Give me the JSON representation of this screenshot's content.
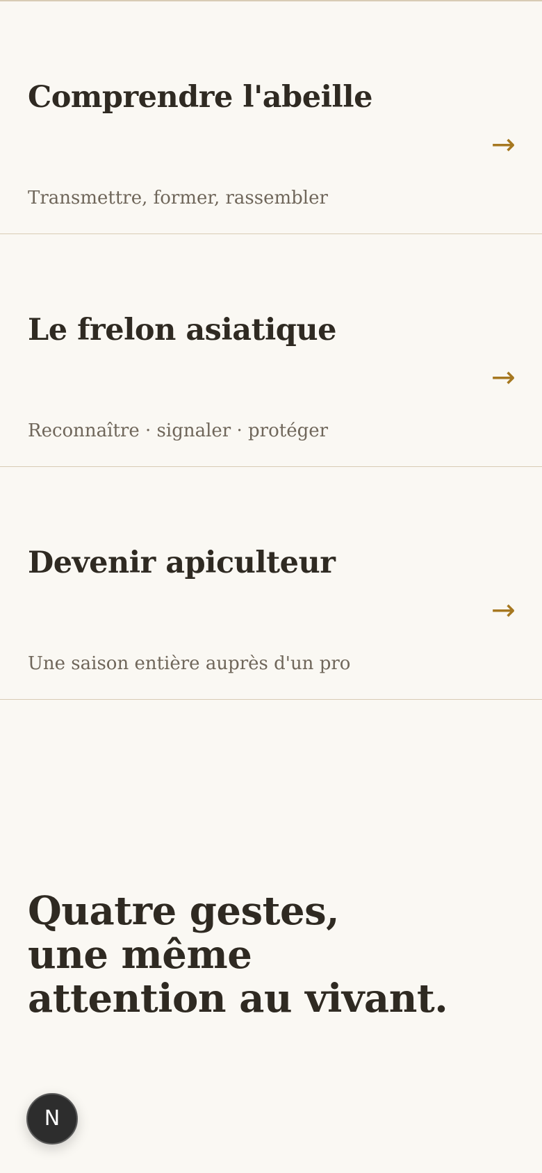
{
  "cards": [
    {
      "title": "Comprendre l'abeille",
      "subtitle": "Transmettre, former, rassembler",
      "arrow": "→"
    },
    {
      "title": "Le frelon asiatique",
      "subtitle": "Reconnaître · signaler · protéger",
      "arrow": "→"
    },
    {
      "title": "Devenir apiculteur",
      "subtitle": "Une saison entière auprès d'un pro",
      "arrow": "→"
    }
  ],
  "tagline": {
    "line1": "Quatre gestes,",
    "line2": "une même",
    "line3": "attention au vivant."
  },
  "badge": {
    "letter": "N"
  },
  "colors": {
    "background": "#faf8f3",
    "text": "#2f2a22",
    "muted_text": "#6f665a",
    "accent": "#a67820",
    "divider": "#d8cbb4",
    "badge": "#2d2d2d"
  },
  "icons": {
    "card_arrow": "arrow-right-icon",
    "badge": "nextjs-logo-icon"
  }
}
